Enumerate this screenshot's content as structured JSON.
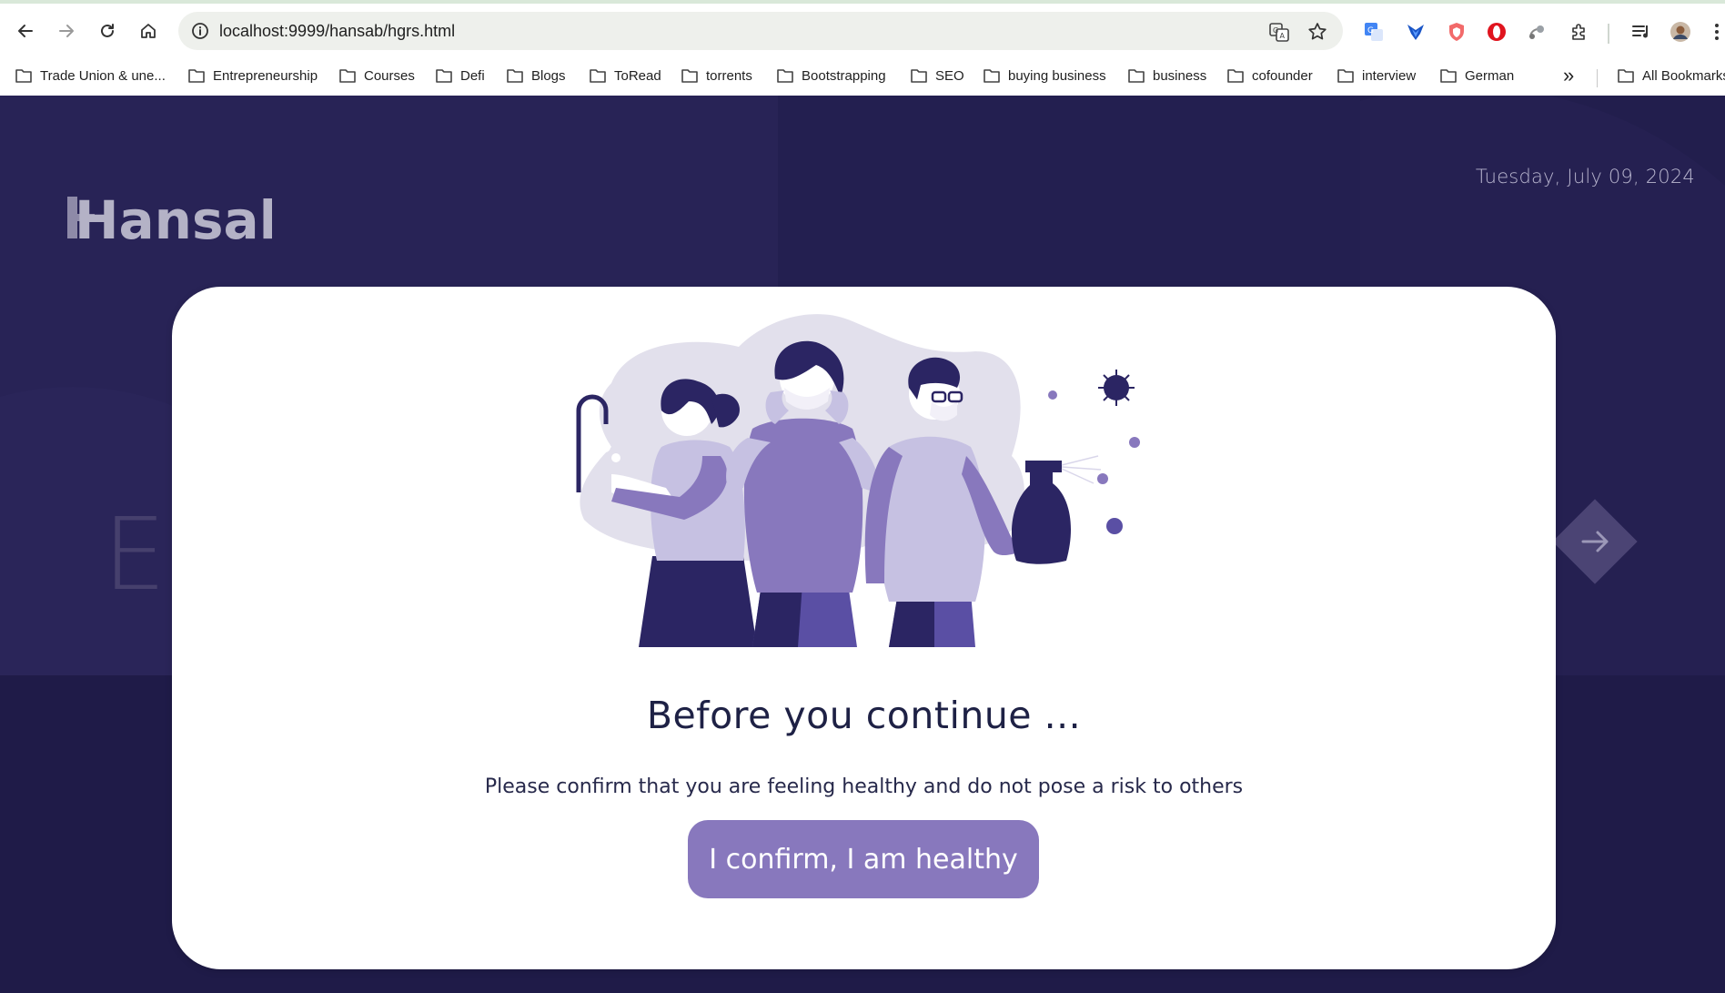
{
  "browser": {
    "url": "localhost:9999/hansab/hgrs.html",
    "bookmarks": [
      "Trade Union & une...",
      "Entrepreneurship",
      "Courses",
      "Defi",
      "Blogs",
      "ToRead",
      "torrents",
      "Bootstrapping",
      "SEO",
      "buying business",
      "business",
      "cofounder",
      "interview",
      "German"
    ],
    "all_bookmarks": "All Bookmarks",
    "overflow_glyph": "»"
  },
  "page": {
    "date": "Tuesday, July 09, 2024",
    "logo_text": "Hansab",
    "background_letter": "E",
    "colors": {
      "background": "#221e4d",
      "accent": "#8878bd",
      "title": "#1e2145"
    }
  },
  "modal": {
    "title": "Before you continue ...",
    "message": "Please confirm that you are feeling healthy and do not pose a risk to others",
    "confirm_label": "I confirm, I am healthy"
  }
}
